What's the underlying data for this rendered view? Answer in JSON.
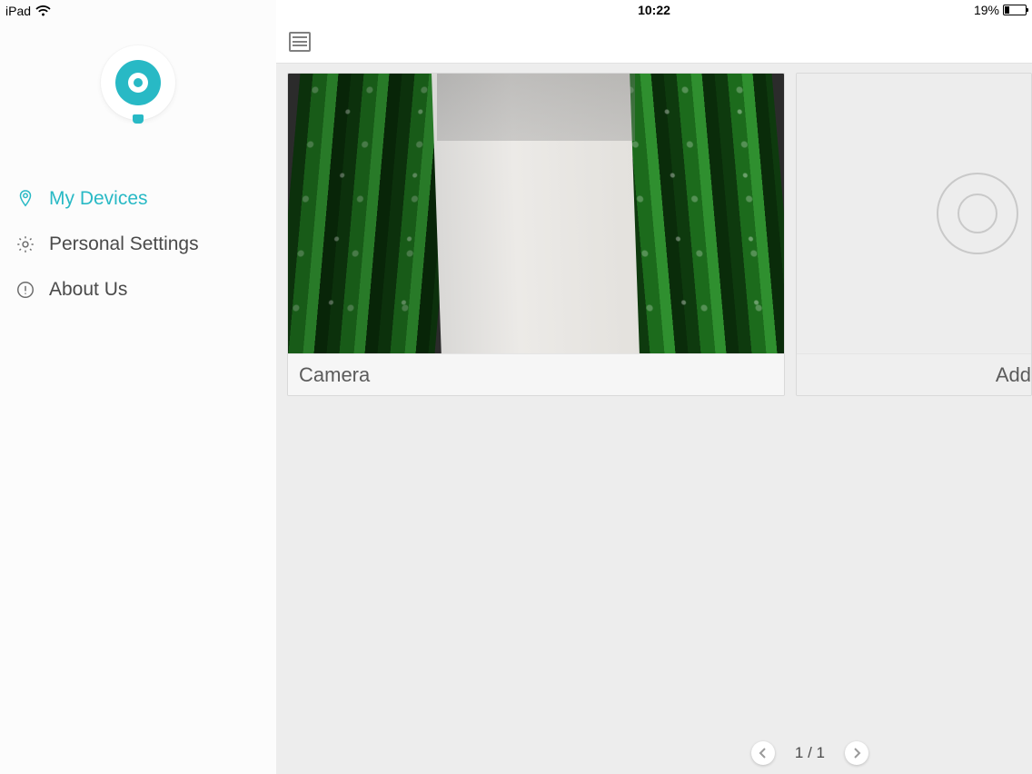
{
  "statusbar": {
    "device": "iPad",
    "time": "10:22",
    "battery_pct_label": "19%",
    "battery_pct": 19
  },
  "sidebar": {
    "active_index": 0,
    "items": [
      {
        "icon": "location-pin-icon",
        "label": "My Devices"
      },
      {
        "icon": "gear-icon",
        "label": "Personal Settings"
      },
      {
        "icon": "info-icon",
        "label": "About Us"
      }
    ]
  },
  "main": {
    "cards": [
      {
        "kind": "camera",
        "label": "Camera"
      },
      {
        "kind": "add",
        "label": "Add"
      }
    ]
  },
  "pager": {
    "current": 1,
    "total": 1,
    "label": "1 / 1"
  },
  "colors": {
    "accent": "#28b9c5",
    "text": "#4a4a4a",
    "bg_main": "#ededed"
  }
}
